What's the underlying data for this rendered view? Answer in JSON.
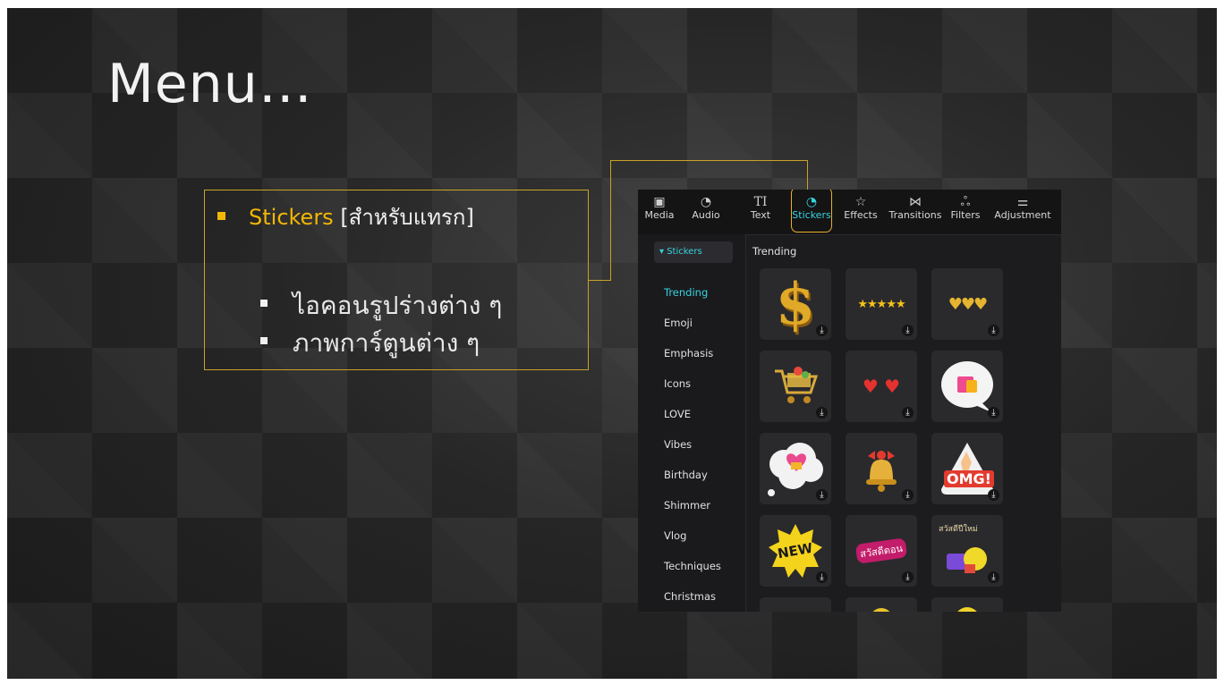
{
  "slide": {
    "title": "Menu…",
    "bullet": {
      "highlight": "Stickers",
      "rest": " [สำหรับแทรก]",
      "subitems": [
        "ไอคอนรูปร่างต่าง ๆ",
        "ภาพการ์ตูนต่าง ๆ"
      ]
    }
  },
  "app": {
    "toolbar": [
      {
        "label": "Media",
        "icon": "media-icon",
        "glyph": "▣"
      },
      {
        "label": "Audio",
        "icon": "audio-icon",
        "glyph": "◔"
      },
      {
        "label": "Text",
        "icon": "text-icon",
        "glyph": "TI"
      },
      {
        "label": "Stickers",
        "icon": "stickers-icon",
        "glyph": "◔"
      },
      {
        "label": "Effects",
        "icon": "effects-icon",
        "glyph": "☆"
      },
      {
        "label": "Transitions",
        "icon": "transitions-icon",
        "glyph": "⋈"
      },
      {
        "label": "Filters",
        "icon": "filters-icon",
        "glyph": "ஃ"
      },
      {
        "label": "Adjustment",
        "icon": "adjustment-icon",
        "glyph": "⚌"
      }
    ],
    "active_tab": "Stickers",
    "accent": "#37d3e0",
    "ring_color": "#e8b12b",
    "sidebar": {
      "header": "▾ Stickers",
      "items": [
        "Trending",
        "Emoji",
        "Emphasis",
        "Icons",
        "LOVE",
        "Vibes",
        "Birthday",
        "Shimmer",
        "Vlog",
        "Techniques",
        "Christmas"
      ],
      "selected": "Trending"
    },
    "grid": {
      "title": "Trending",
      "download_glyph": "⤓",
      "stickers": [
        {
          "name": "dollar-sign-sticker",
          "text": "$"
        },
        {
          "name": "five-stars-sticker",
          "text": "★★★★★"
        },
        {
          "name": "gold-hearts-sticker",
          "text": "♥♥♥"
        },
        {
          "name": "shopping-cart-sticker",
          "text": "🛒"
        },
        {
          "name": "red-hearts-sticker",
          "text": "♥ ♥"
        },
        {
          "name": "shopping-bag-bubble-sticker",
          "text": "🛍"
        },
        {
          "name": "heart-gift-cloud-sticker",
          "text": "💝"
        },
        {
          "name": "bell-bow-sticker",
          "text": "🔔"
        },
        {
          "name": "omg-clap-sticker",
          "text": "OMG!"
        },
        {
          "name": "new-burst-sticker",
          "text": "NEW"
        },
        {
          "name": "script-text-sticker",
          "text": "สวัสดีตอน"
        },
        {
          "name": "cartoon-collage-sticker",
          "text": "สวัสดีปีใหม่"
        },
        {
          "name": "partial-sticker-1",
          "text": ""
        },
        {
          "name": "partial-sticker-2",
          "text": ""
        },
        {
          "name": "partial-sticker-3",
          "text": ""
        }
      ]
    }
  }
}
